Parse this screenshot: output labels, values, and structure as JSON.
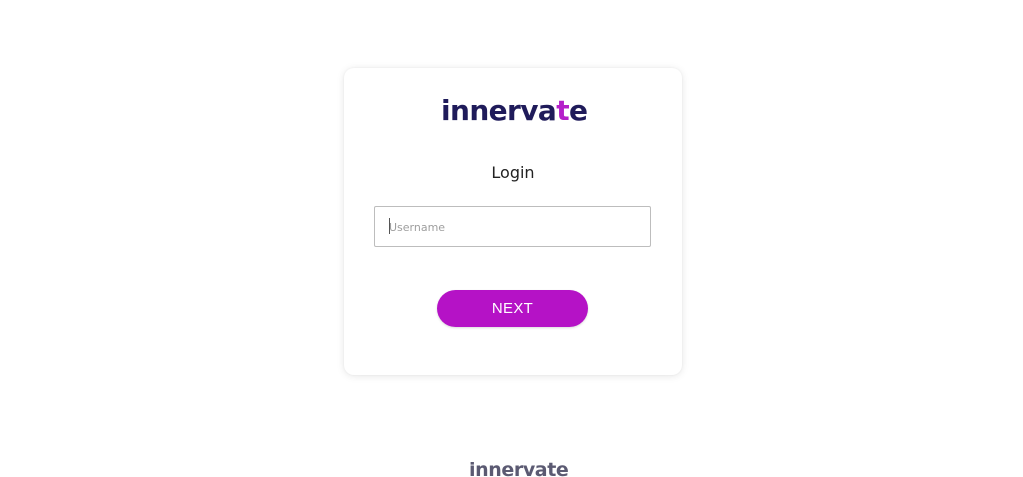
{
  "brand": {
    "logo_prefix": "innerva",
    "logo_accent": "t",
    "logo_suffix": "e",
    "logo_color": "#1f1b5a",
    "accent_color": "#b520c9"
  },
  "login": {
    "title": "Login",
    "username_placeholder": "Username",
    "username_value": "",
    "next_label": "NEXT",
    "button_color": "#b512c6"
  },
  "footer": {
    "logo_text": "innervate"
  }
}
